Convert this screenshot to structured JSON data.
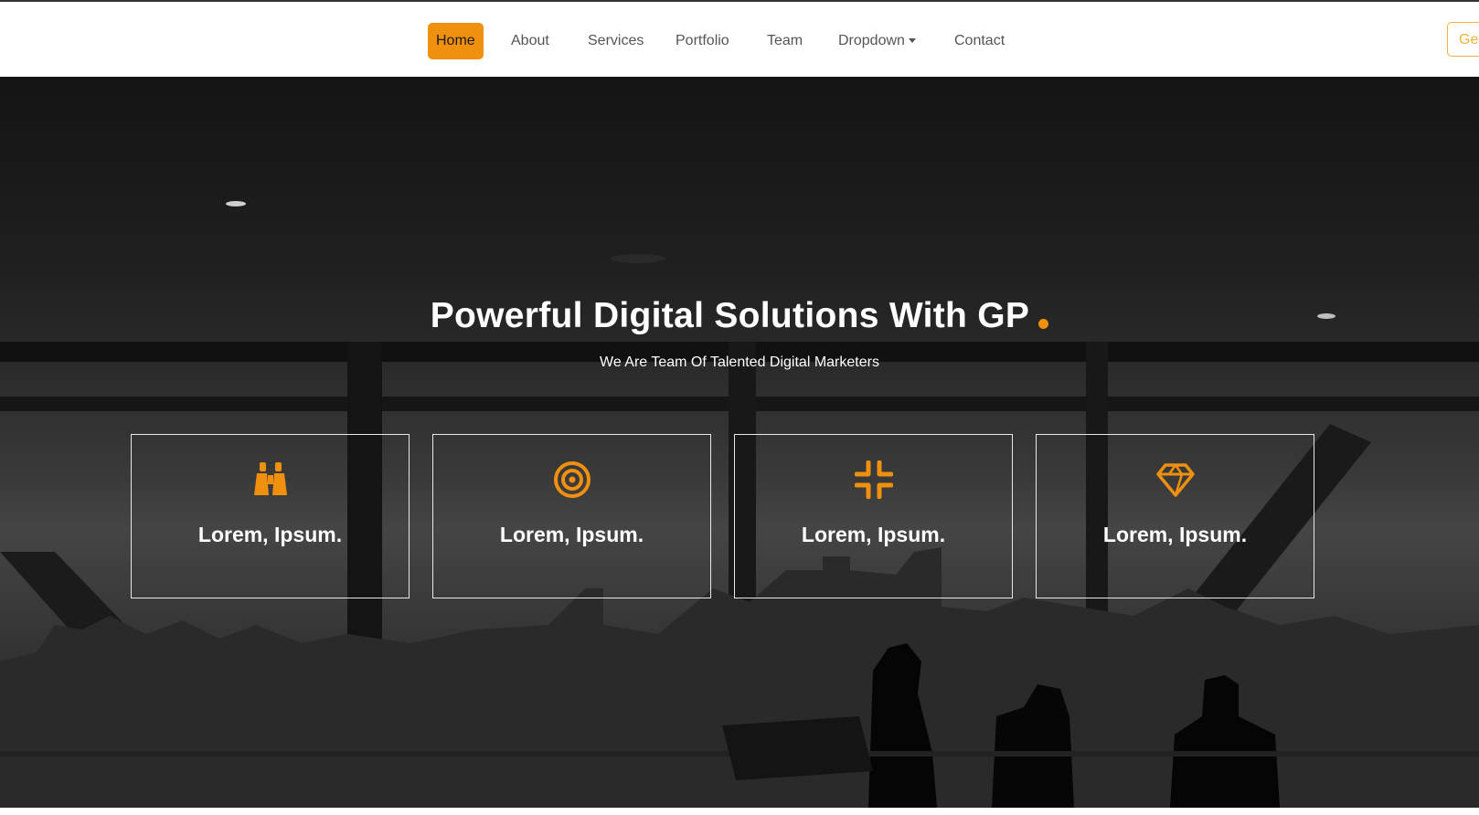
{
  "nav": {
    "items": [
      {
        "label": "Home",
        "active": true
      },
      {
        "label": "About"
      },
      {
        "label": "Services"
      },
      {
        "label": "Portfolio"
      },
      {
        "label": "Team"
      },
      {
        "label": "Dropdown",
        "has_caret": true
      },
      {
        "label": "Contact"
      }
    ],
    "cta_label": "Get"
  },
  "hero": {
    "title": "Powerful Digital Solutions With GP",
    "subtitle": "We Are Team Of Talented Digital Marketers"
  },
  "cards": [
    {
      "icon": "binoculars-icon",
      "title": "Lorem, Ipsum."
    },
    {
      "icon": "target-icon",
      "title": "Lorem, Ipsum."
    },
    {
      "icon": "compress-icon",
      "title": "Lorem, Ipsum."
    },
    {
      "icon": "gem-icon",
      "title": "Lorem, Ipsum."
    }
  ],
  "colors": {
    "accent": "#f0900f",
    "cta_border": "#f0b23a"
  }
}
